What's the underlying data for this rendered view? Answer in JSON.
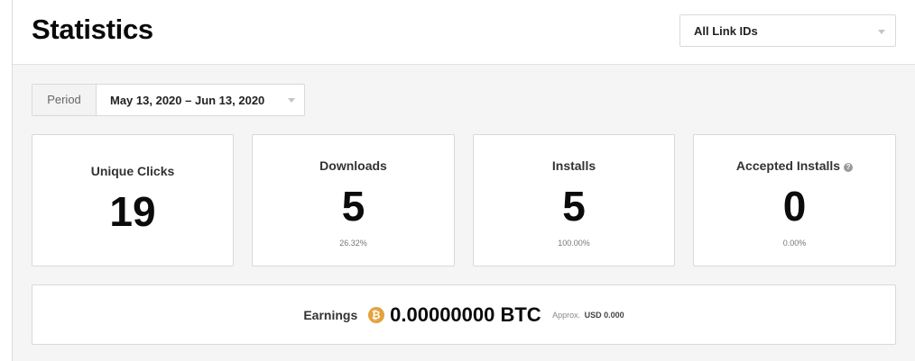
{
  "header": {
    "title": "Statistics",
    "link_filter": {
      "selected": "All Link IDs"
    }
  },
  "period": {
    "label": "Period",
    "range": "May 13, 2020 – Jun 13, 2020"
  },
  "stats": {
    "unique_clicks": {
      "label": "Unique Clicks",
      "value": "19"
    },
    "downloads": {
      "label": "Downloads",
      "value": "5",
      "percent": "26.32%"
    },
    "installs": {
      "label": "Installs",
      "value": "5",
      "percent": "100.00%"
    },
    "accepted_installs": {
      "label": "Accepted Installs",
      "value": "0",
      "percent": "0.00%"
    }
  },
  "earnings": {
    "label": "Earnings",
    "currency_icon": "bitcoin-icon",
    "amount": "0.00000000 BTC",
    "approx_label": "Approx.",
    "approx_value": "USD 0.000"
  },
  "colors": {
    "background": "#f5f5f5",
    "card": "#ffffff",
    "border": "#d9d9d9",
    "bitcoin": "#e5a23c"
  }
}
